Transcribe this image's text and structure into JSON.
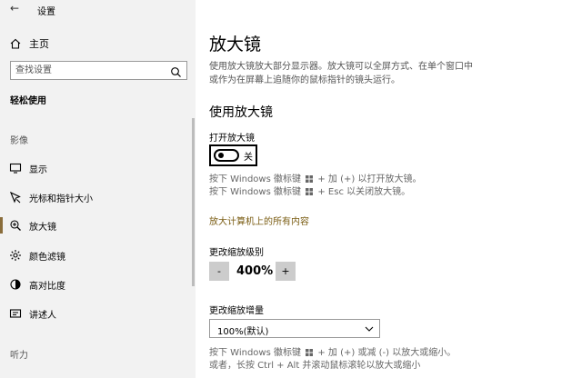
{
  "titlebar": {
    "app_title": "设置",
    "back_icon": "back-arrow-icon"
  },
  "sidebar": {
    "home": {
      "label": "主页",
      "icon": "home-icon"
    },
    "search": {
      "placeholder": "查找设置",
      "icon": "search-icon"
    },
    "section_title": "轻松使用",
    "group_vision": "影像",
    "items": [
      {
        "label": "显示",
        "icon": "display-icon"
      },
      {
        "label": "光标和指针大小",
        "icon": "cursor-icon"
      },
      {
        "label": "放大镜",
        "icon": "magnifier-icon",
        "active": true
      },
      {
        "label": "颜色滤镜",
        "icon": "color-filter-icon"
      },
      {
        "label": "高对比度",
        "icon": "high-contrast-icon"
      },
      {
        "label": "讲述人",
        "icon": "narrator-icon"
      }
    ],
    "group_hearing": "听力"
  },
  "main": {
    "title": "放大镜",
    "description": "使用放大镜放大部分显示器。放大镜可以全屏方式、在单个窗口中或作为在屏幕上追随你的鼠标指针的镜头运行。",
    "description_line1": "使用放大镜放大部分显示器。放大镜可以全屏方式、在单个窗口中",
    "description_line2": "或作为在屏幕上追随你的鼠标指针的镜头运行。",
    "section_title": "使用放大镜",
    "toggle_label": "打开放大镜",
    "toggle_state": "关",
    "hint1_pre": "按下 Windows 徽标键",
    "hint1_post": "+ 加 (+) 以打开放大镜。",
    "hint2_pre": "按下 Windows 徽标键",
    "hint2_post": "+ Esc 以关闭放大镜。",
    "link": "放大计算机上的所有内容",
    "zoom_label": "更改缩放级别",
    "zoom_minus": "-",
    "zoom_value": "400%",
    "zoom_plus": "+",
    "increment_label": "更改缩放增量",
    "increment_value": "100%(默认)",
    "hint3_pre": "按下 Windows 徽标键",
    "hint3_post": "+ 加 (+) 或减 (-) 以放大或缩小。",
    "hint4": "或者，长按 Ctrl + Alt 并滚动鼠标滚轮以放大或缩小",
    "accent_color": "#8a6d3b"
  }
}
